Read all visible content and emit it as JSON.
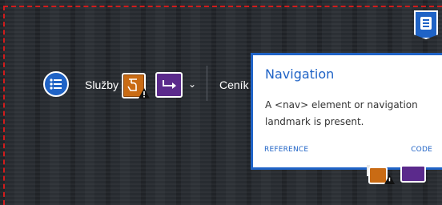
{
  "nav": {
    "items": [
      {
        "label": "Služby"
      },
      {
        "label": "Ceník"
      }
    ],
    "menu_icon": "list-icon",
    "chevron_icon": "chevron-down-icon"
  },
  "overlays": {
    "landmark_icon": "navigation-landmark-icon",
    "badges": [
      "touch-target-warning-icon",
      "skip-link-icon",
      "warning-icon"
    ]
  },
  "popover": {
    "title": "Navigation",
    "body": "A <nav> element or navigation landmark is present.",
    "reference_label": "REFERENCE",
    "code_label": "CODE"
  },
  "colors": {
    "accent": "#1f63c6",
    "warning_orange": "#c96b14",
    "purple": "#5b2a8c",
    "outline_red": "#d11c1c",
    "background": "#272b30"
  }
}
